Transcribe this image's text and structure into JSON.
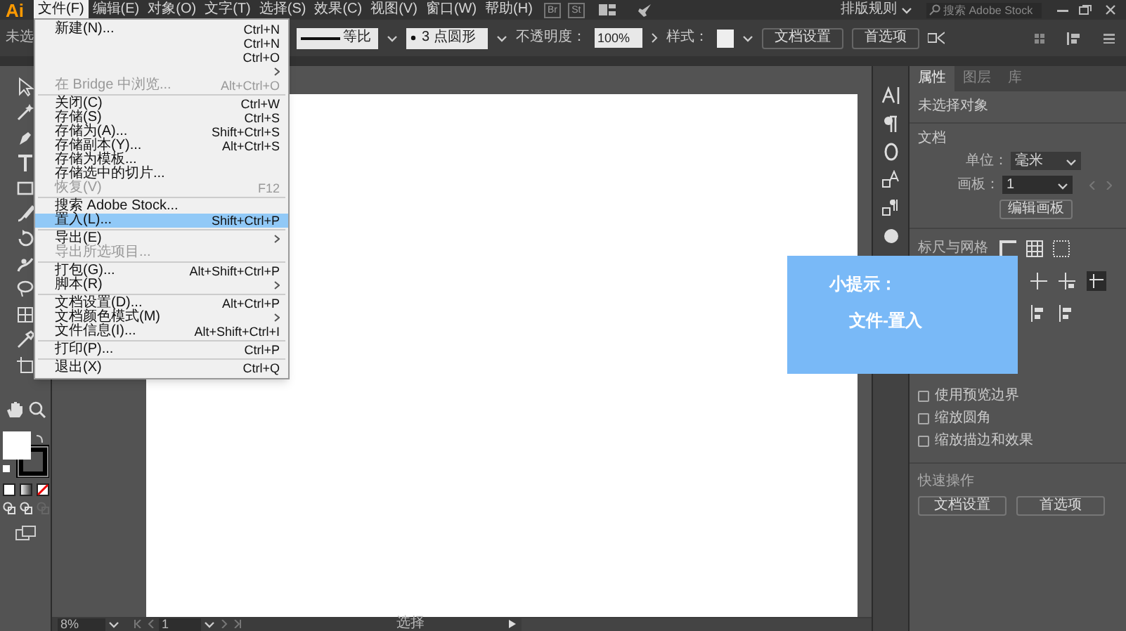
{
  "app": {
    "logo": "Ai"
  },
  "menubar": [
    {
      "label": "文件(F)",
      "selected": true
    },
    {
      "label": "编辑(E)",
      "selected": false
    },
    {
      "label": "对象(O)",
      "selected": false
    },
    {
      "label": "文字(T)",
      "selected": false
    },
    {
      "label": "选择(S)",
      "selected": false
    },
    {
      "label": "效果(C)",
      "selected": false
    },
    {
      "label": "视图(V)",
      "selected": false
    },
    {
      "label": "窗口(W)",
      "selected": false
    },
    {
      "label": "帮助(H)",
      "selected": false
    }
  ],
  "bridge_icons": [
    "Br",
    "St"
  ],
  "workspace": {
    "label": "排版规则"
  },
  "search": {
    "placeholder": "搜索 Adobe Stock"
  },
  "control_bar": {
    "selection": "未选",
    "stroke_label": "等比",
    "brush": "3 点圆形",
    "opacity_label": "不透明度：",
    "opacity": "100%",
    "style_label": "样式：",
    "buttons": [
      "文档设置",
      "首选项"
    ]
  },
  "file_menu": [
    {
      "kind": "item",
      "label": "新建(N)...",
      "shortcut": "Ctrl+N",
      "disabled": false,
      "selected": false
    },
    {
      "kind": "item",
      "shortcut": "Ctrl+N",
      "disabled": false,
      "selected": false
    },
    {
      "kind": "item",
      "shortcut": "Ctrl+O",
      "disabled": false,
      "selected": false
    },
    {
      "kind": "submenu",
      "disabled": false,
      "selected": false
    },
    {
      "kind": "item",
      "label": "在 Bridge 中浏览...",
      "shortcut": "Alt+Ctrl+O",
      "disabled": true,
      "selected": false
    },
    {
      "kind": "separator"
    },
    {
      "kind": "item",
      "label": "关闭(C)",
      "shortcut": "Ctrl+W",
      "disabled": false,
      "selected": false
    },
    {
      "kind": "item",
      "label": "存储(S)",
      "shortcut": "Ctrl+S",
      "disabled": false,
      "selected": false
    },
    {
      "kind": "item",
      "label": "存储为(A)...",
      "shortcut": "Shift+Ctrl+S",
      "disabled": false,
      "selected": false
    },
    {
      "kind": "item",
      "label": "存储副本(Y)...",
      "shortcut": "Alt+Ctrl+S",
      "disabled": false,
      "selected": false
    },
    {
      "kind": "item",
      "label": "存储为模板...",
      "disabled": false,
      "selected": false
    },
    {
      "kind": "item",
      "label": "存储选中的切片...",
      "disabled": false,
      "selected": false
    },
    {
      "kind": "item",
      "label": "恢复(V)",
      "shortcut": "F12",
      "disabled": true,
      "selected": false
    },
    {
      "kind": "separator"
    },
    {
      "kind": "item",
      "label": "搜索 Adobe Stock...",
      "disabled": false,
      "selected": false
    },
    {
      "kind": "item",
      "label": "置入(L)...",
      "shortcut": "Shift+Ctrl+P",
      "disabled": false,
      "selected": true
    },
    {
      "kind": "separator"
    },
    {
      "kind": "submenu",
      "label": "导出(E)",
      "disabled": false,
      "selected": false
    },
    {
      "kind": "item",
      "label": "导出所选项目...",
      "disabled": true,
      "selected": false
    },
    {
      "kind": "separator"
    },
    {
      "kind": "item",
      "label": "打包(G)...",
      "shortcut": "Alt+Shift+Ctrl+P",
      "disabled": false,
      "selected": false
    },
    {
      "kind": "submenu",
      "label": "脚本(R)",
      "disabled": false,
      "selected": false
    },
    {
      "kind": "separator"
    },
    {
      "kind": "item",
      "label": "文档设置(D)...",
      "shortcut": "Alt+Ctrl+P",
      "disabled": false,
      "selected": false
    },
    {
      "kind": "submenu",
      "label": "文档颜色模式(M)",
      "disabled": false,
      "selected": false
    },
    {
      "kind": "item",
      "label": "文件信息(I)...",
      "shortcut": "Alt+Shift+Ctrl+I",
      "disabled": false,
      "selected": false
    },
    {
      "kind": "separator"
    },
    {
      "kind": "item",
      "label": "打印(P)...",
      "shortcut": "Ctrl+P",
      "disabled": false,
      "selected": false
    },
    {
      "kind": "separator"
    },
    {
      "kind": "item",
      "label": "退出(X)",
      "shortcut": "Ctrl+Q",
      "disabled": false,
      "selected": false
    }
  ],
  "panel": {
    "tabs": [
      {
        "label": "属性",
        "selected": true
      },
      {
        "label": "图层",
        "selected": false
      },
      {
        "label": "库",
        "selected": false
      }
    ],
    "selection": "未选择对象",
    "document_title": "文档",
    "unit_label": "单位：",
    "unit": "毫米",
    "artboard_label": "画板：",
    "artboard": "1",
    "edit_artboard": "编辑画板",
    "rulers_title": "标尺与网格",
    "options": [
      {
        "label": "使用预览边界",
        "checked": false
      },
      {
        "label": "缩放圆角",
        "checked": false
      },
      {
        "label": "缩放描边和效果",
        "checked": false
      }
    ],
    "quick_title": "快速操作",
    "quick_buttons": [
      "文档设置",
      "首选项"
    ]
  },
  "tip": {
    "title": "小提示：",
    "text": "文件-置入"
  },
  "status_bar": {
    "zoom": "8%",
    "page": "1",
    "tool": "选择"
  }
}
